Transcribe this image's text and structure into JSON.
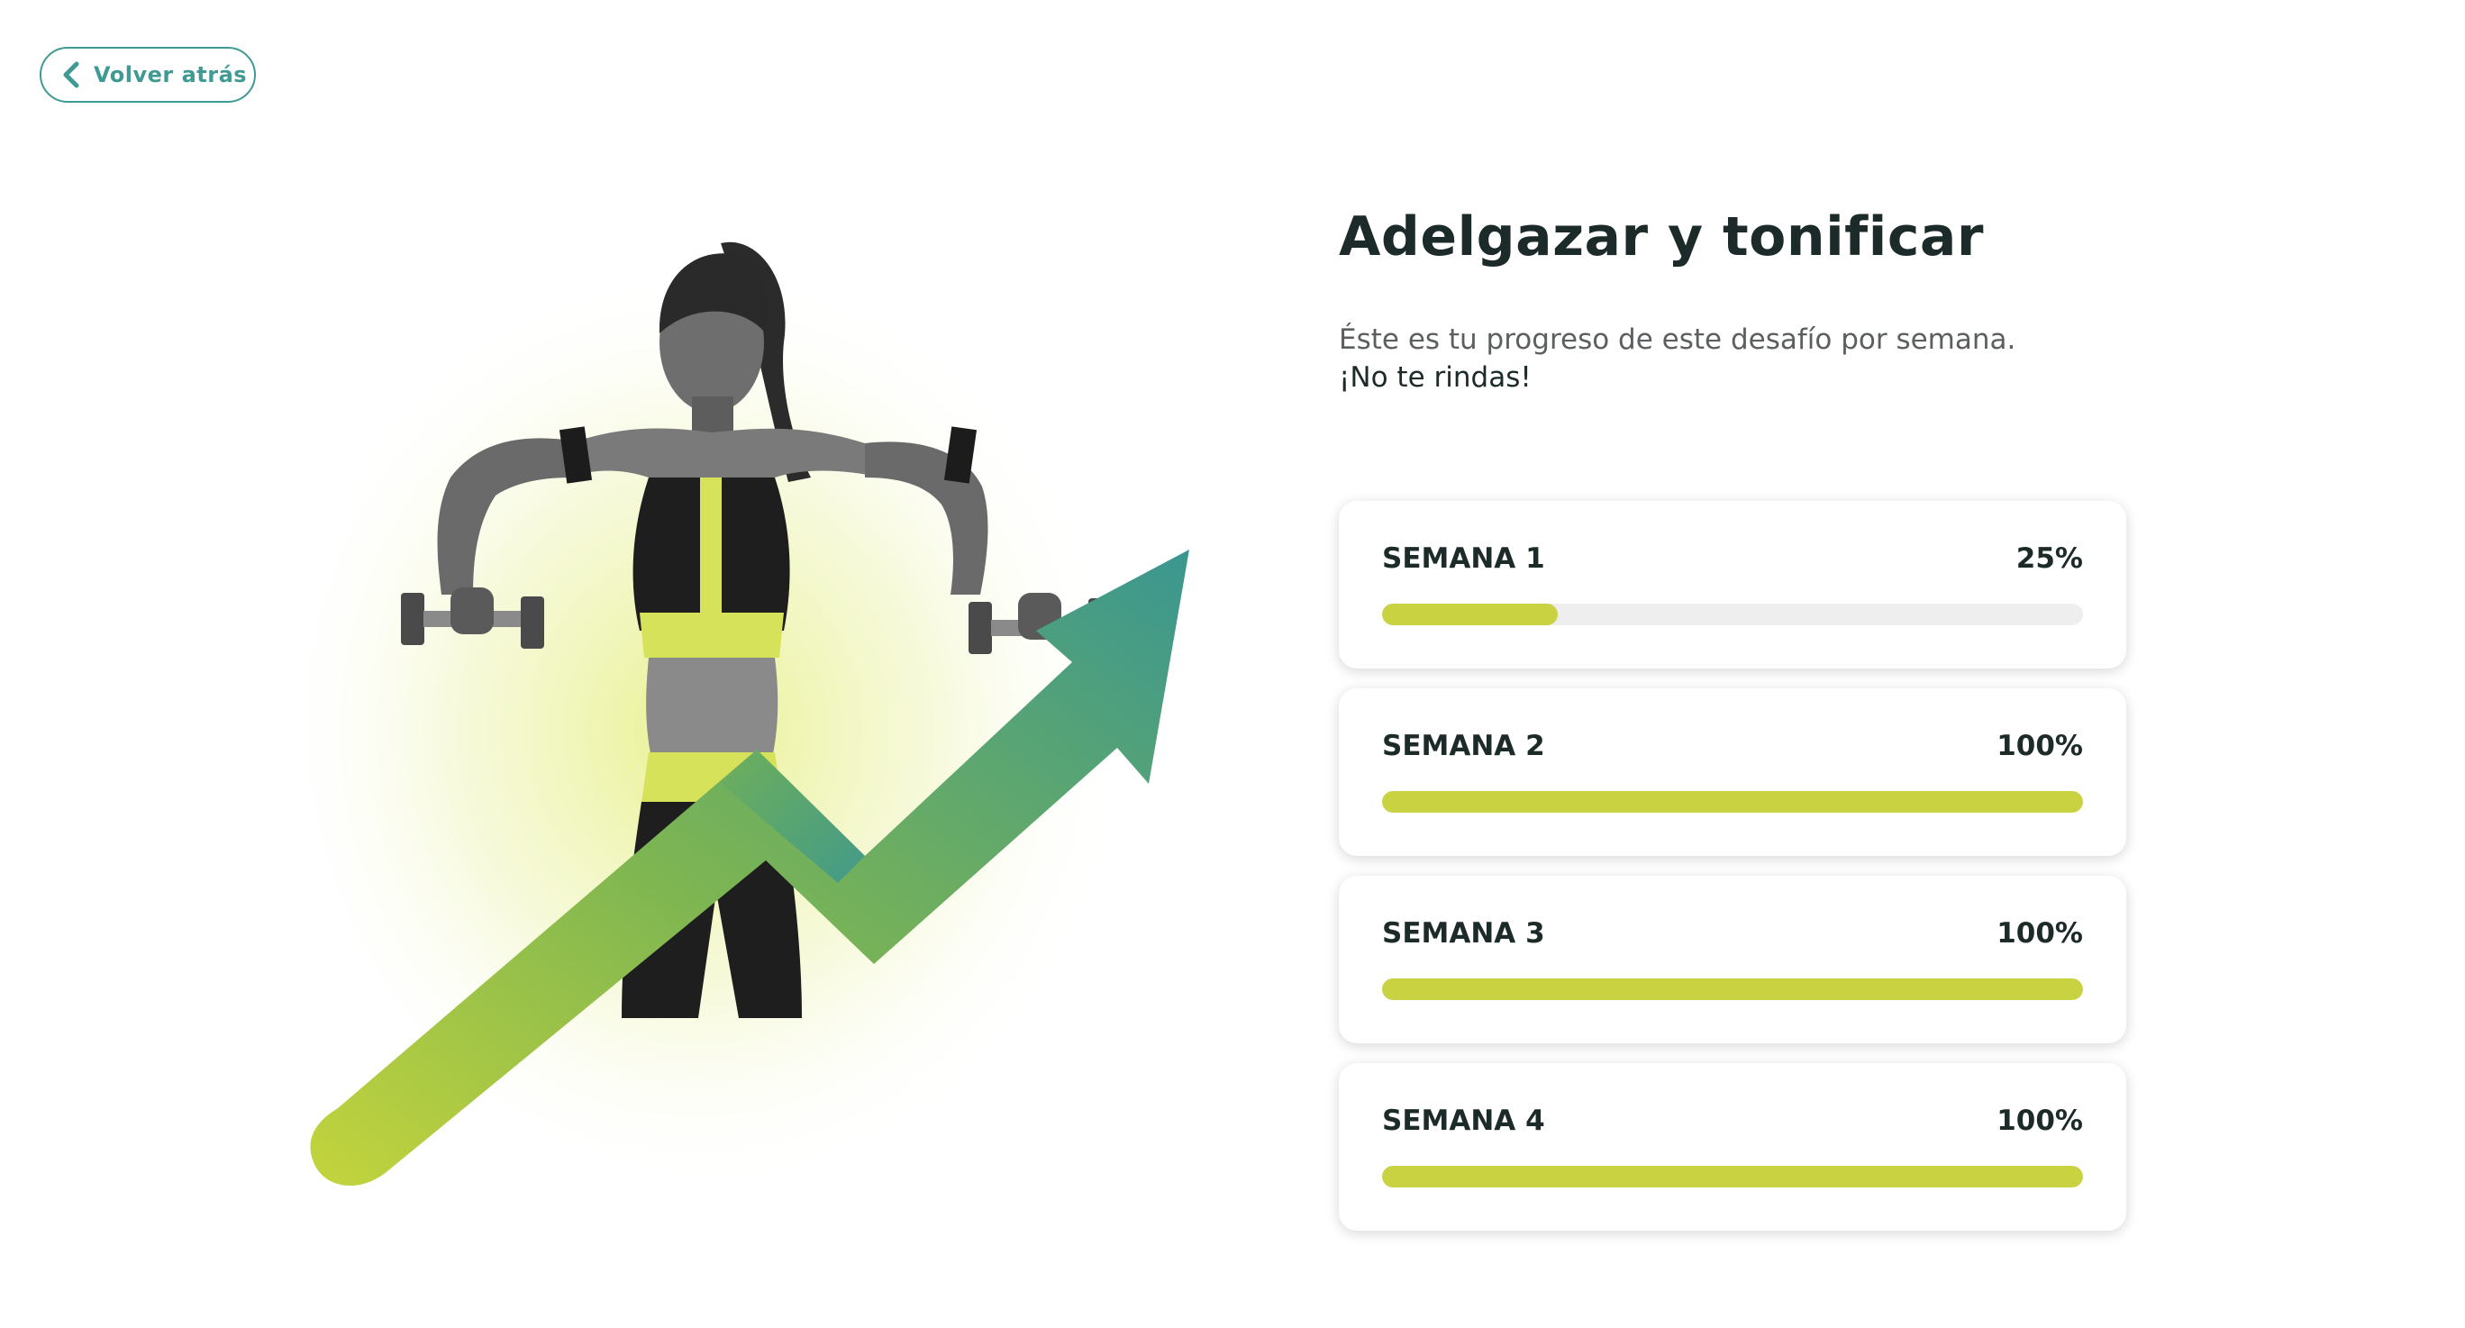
{
  "back_button": {
    "label": "Volver atrás",
    "icon": "chevron-left-icon"
  },
  "title": "Adelgazar y tonificar",
  "subtitle": {
    "line1": "Éste es tu progreso de este desafío por semana.",
    "line2": "¡No te rindas!"
  },
  "weeks": [
    {
      "label": "SEMANA 1",
      "percent_text": "25%",
      "progress": 0.25
    },
    {
      "label": "SEMANA 2",
      "percent_text": "100%",
      "progress": 1.0
    },
    {
      "label": "SEMANA 3",
      "percent_text": "100%",
      "progress": 1.0
    },
    {
      "label": "SEMANA 4",
      "percent_text": "100%",
      "progress": 1.0
    }
  ],
  "colors": {
    "accent_teal": "#3f9a94",
    "progress_fill": "#c9d342",
    "progress_track": "#eeeeee",
    "text_dark": "#1c2b2a",
    "text_muted": "#5b5f60"
  }
}
